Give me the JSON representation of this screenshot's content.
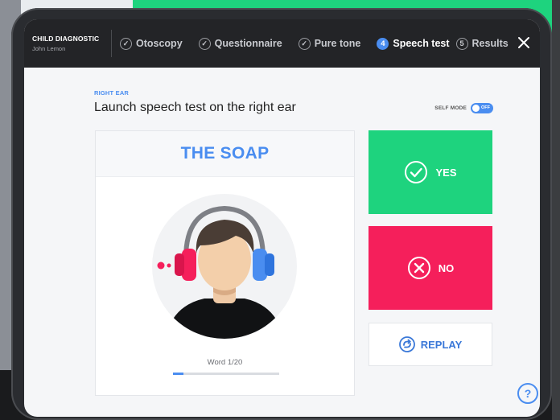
{
  "header": {
    "brand_title": "CHILD DIAGNOSTIC",
    "user_name": "John Lemon",
    "steps": [
      {
        "label": "Otoscopy",
        "marker": "check",
        "state": "done"
      },
      {
        "label": "Questionnaire",
        "marker": "check",
        "state": "done"
      },
      {
        "label": "Pure tone",
        "marker": "check",
        "state": "done"
      },
      {
        "label": "Speech test",
        "marker": "4",
        "state": "active"
      },
      {
        "label": "Results",
        "marker": "5",
        "state": "upcoming"
      }
    ],
    "close_icon": "close-icon"
  },
  "main": {
    "ear_label": "RIGHT EAR",
    "heading": "Launch speech test on the right ear",
    "self_mode": {
      "label": "SELF MODE",
      "state_text": "OFF"
    },
    "word_card": {
      "word": "THE SOAP",
      "word_counter": "Word 1/20",
      "progress": 0.1
    },
    "answers": {
      "yes_label": "YES",
      "no_label": "NO",
      "replay_label": "REPLAY"
    },
    "help_label": "?"
  },
  "colors": {
    "accent_blue": "#4a8df0",
    "yes_green": "#1ed37e",
    "no_red": "#f51f5b",
    "topbar_dark": "#232427",
    "background_green": "#1ed37e"
  }
}
